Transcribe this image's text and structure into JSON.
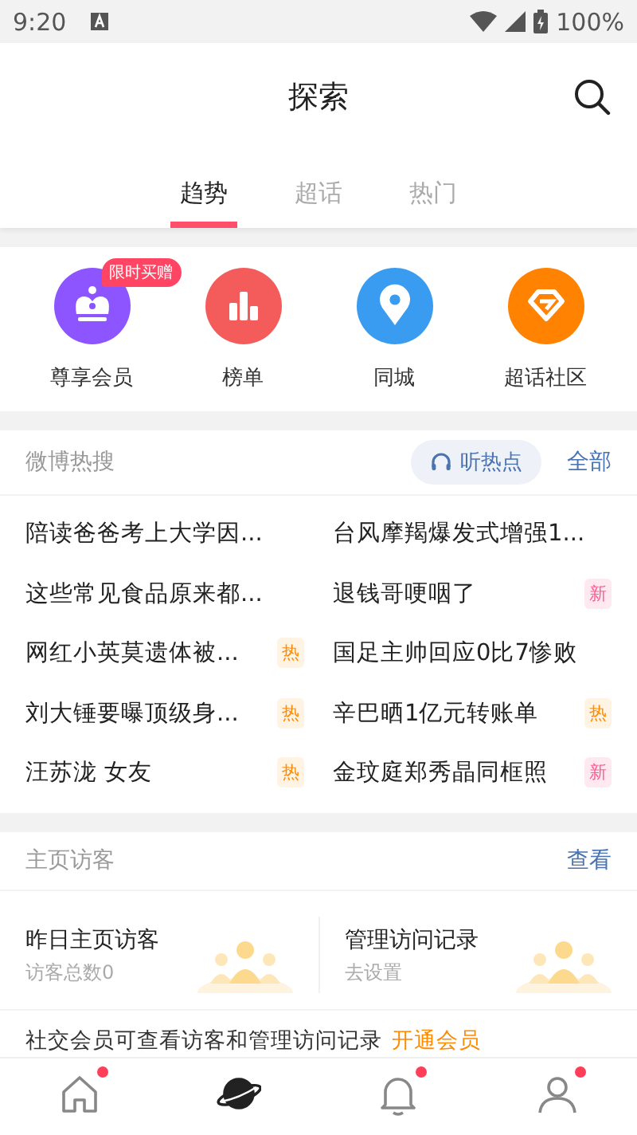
{
  "status_bar": {
    "time": "9:20",
    "battery": "100%"
  },
  "header": {
    "title": "探索"
  },
  "tabs": [
    {
      "label": "趋势",
      "selected": true
    },
    {
      "label": "超话",
      "selected": false
    },
    {
      "label": "热门",
      "selected": false
    }
  ],
  "shortcuts": [
    {
      "label": "尊享会员",
      "kind": "crown",
      "color": "#8c55ff",
      "badge": "限时买赠"
    },
    {
      "label": "榜单",
      "kind": "chart",
      "color": "#f45c5c"
    },
    {
      "label": "同城",
      "kind": "pin",
      "color": "#3a9cf0"
    },
    {
      "label": "超话社区",
      "kind": "diamond",
      "color": "#ff8200"
    }
  ],
  "hot_search": {
    "title": "微博热搜",
    "listen_button": "听热点",
    "all_link": "全部",
    "items": [
      {
        "text": "陪读爸爸考上大学因..."
      },
      {
        "text": "台风摩羯爆发式增强1..."
      },
      {
        "text": "这些常见食品原来都..."
      },
      {
        "text": "退钱哥哽咽了",
        "badge": {
          "text": "新",
          "kind": "new"
        }
      },
      {
        "text": "网红小英莫遗体被...",
        "badge": {
          "text": "热",
          "kind": "hot"
        }
      },
      {
        "text": "国足主帅回应0比7惨败"
      },
      {
        "text": "刘大锤要曝顶级身...",
        "badge": {
          "text": "热",
          "kind": "hot"
        }
      },
      {
        "text": "辛巴晒1亿元转账单",
        "badge": {
          "text": "热",
          "kind": "hot"
        }
      },
      {
        "text": "汪苏泷 女友",
        "badge": {
          "text": "热",
          "kind": "hot"
        }
      },
      {
        "text": "金玟庭郑秀晶同框照",
        "badge": {
          "text": "新",
          "kind": "new"
        }
      }
    ]
  },
  "visitors": {
    "title": "主页访客",
    "view_link": "查看",
    "cards": [
      {
        "title": "昨日主页访客",
        "subtitle": "访客总数0"
      },
      {
        "title": "管理访问记录",
        "subtitle": "去设置"
      }
    ],
    "promo": {
      "text": "社交会员可查看访客和管理访问记录",
      "link": "开通会员"
    }
  },
  "nav": [
    {
      "kind": "home",
      "selected": false,
      "dot": true
    },
    {
      "kind": "discover",
      "selected": true,
      "dot": false
    },
    {
      "kind": "bell",
      "selected": false,
      "dot": true
    },
    {
      "kind": "profile",
      "selected": false,
      "dot": true
    }
  ]
}
